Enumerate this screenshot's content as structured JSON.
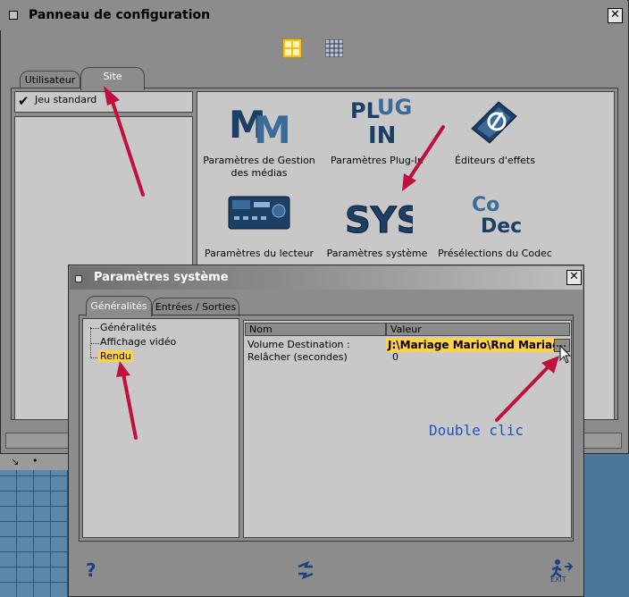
{
  "control_panel": {
    "title": "Panneau de configuration",
    "close_label": "✕",
    "tabs": [
      "Utilisateur",
      "Site"
    ],
    "active_tab": "Site",
    "left_panel": {
      "check_mark": "✔",
      "item": "Jeu standard"
    },
    "icons": [
      {
        "label": "Paramètres de Gestion des médias",
        "icon": "mm-media-icon"
      },
      {
        "label": "Paramètres Plug-In",
        "icon": "plug-in-icon"
      },
      {
        "label": "Éditeurs d'effets",
        "icon": "effects-editor-icon"
      },
      {
        "label": "Paramètres du lecteur",
        "icon": "deck-player-icon"
      },
      {
        "label": "Paramètres système",
        "icon": "sys-icon"
      },
      {
        "label": "Présélections du Codec",
        "icon": "codec-icon"
      }
    ]
  },
  "system_dialog": {
    "title": "Paramètres système",
    "close_label": "✕",
    "tabs": [
      "Généralités",
      "Entrées / Sorties"
    ],
    "active_tab": "Généralités",
    "tree": [
      "Généralités",
      "Affichage vidéo",
      "Rendu"
    ],
    "selected_tree_item": "Rendu",
    "grid": {
      "columns": [
        "Nom",
        "Valeur"
      ],
      "rows": [
        {
          "name": "Volume Destination :",
          "value": "J:\\Mariage Mario\\Rnd Mariage"
        },
        {
          "name": "Relâcher (secondes)",
          "value": "0"
        }
      ]
    },
    "help_label": "?",
    "exit_label": "EXIT"
  },
  "annotation": {
    "text": "Double clic",
    "color": "#1a55c2"
  },
  "colors": {
    "arrow": "#c0103c",
    "highlight": "#ffd24a",
    "panel": "#8c8c8c",
    "content": "#c8c8c8"
  }
}
